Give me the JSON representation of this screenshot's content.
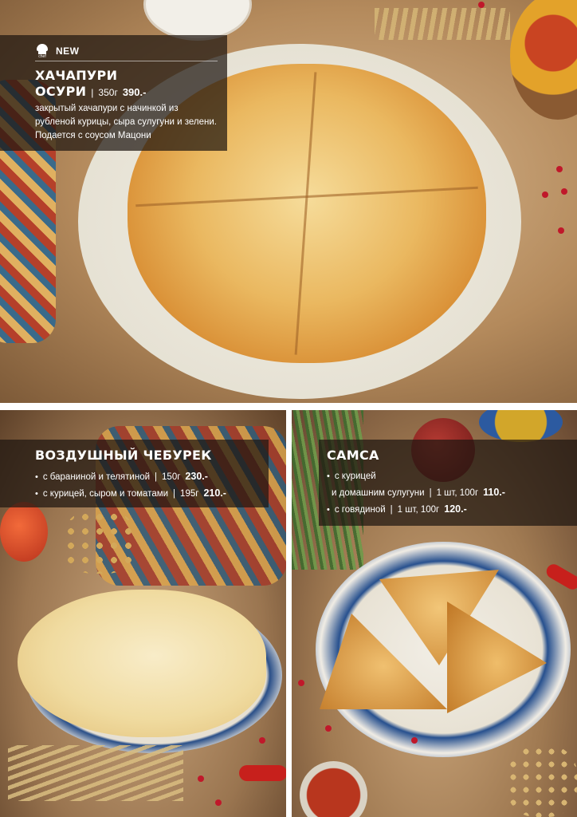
{
  "khachapuri": {
    "badge_icon_text": "chef",
    "badge": "NEW",
    "title_line1": "ХАЧАПУРИ",
    "title_line2": "ОСУРИ",
    "separator": "|",
    "weight": "350г",
    "price": "390.-",
    "description": "закрытый хачапури с начинкой из рубленой курицы, сыра сулугуни и зелени. Подается с соусом Мацони"
  },
  "cheburek": {
    "title": "ВОЗДУШНЫЙ ЧЕБУРЕК",
    "items": [
      {
        "bullet": "•",
        "name": "с бараниной и телятиной",
        "separator": "|",
        "weight": "150г",
        "price": "230.-"
      },
      {
        "bullet": "•",
        "name": "с курицей, сыром и томатами",
        "separator": "|",
        "weight": "195г",
        "price": "210.-"
      }
    ]
  },
  "samsa": {
    "title": "САМСА",
    "items": [
      {
        "bullet": "•",
        "name": "с курицей"
      },
      {
        "name": "и домашним сулугуни",
        "separator": "|",
        "weight": "1 шт, 100г",
        "price": "110.-"
      },
      {
        "bullet": "•",
        "name": "с говядиной",
        "separator": "|",
        "weight": "1 шт, 100г",
        "price": "120.-"
      }
    ]
  },
  "colors": {
    "overlay": "#1e1610",
    "text": "#ffffff",
    "pomegranate": "#c0182a"
  }
}
